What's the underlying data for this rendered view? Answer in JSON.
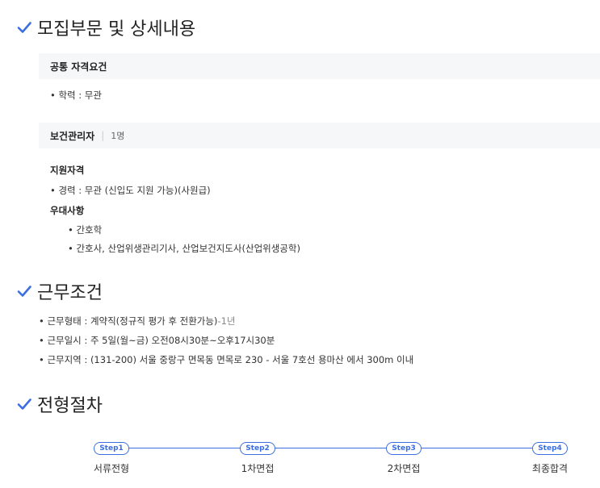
{
  "sections": {
    "recruit": {
      "title": "모집부문 및 상세내용"
    },
    "conditions": {
      "title": "근무조건"
    },
    "process": {
      "title": "전형절차"
    }
  },
  "common": {
    "header": "공통 자격요건",
    "items": [
      "• 학력 : 무관"
    ]
  },
  "position": {
    "name": "보건관리자",
    "count": "1명",
    "qual_title": "지원자격",
    "qual_items": [
      "• 경력 : 무관 (신입도 지원 가능)(사원급)"
    ],
    "pref_title": "우대사항",
    "pref_items": [
      "• 간호학",
      "• 간호사, 산업위생관리기사, 산업보건지도사(산업위생공학)"
    ]
  },
  "conditions": {
    "type_label": "• 근무형태 : 계약직(정규직 평가 후 전환가능)",
    "type_suffix": "-1년",
    "days": "• 근무일시 : 주 5일(월~금) 오전08시30분~오후17시30분",
    "location": "• 근무지역 : (131-200) 서울 중랑구 면목동 면목로 230 - 서울 7호선 용마산 에서 300m 이내"
  },
  "steps": [
    {
      "tag": "Step1",
      "label": "서류전형"
    },
    {
      "tag": "Step2",
      "label": "1차면접"
    },
    {
      "tag": "Step3",
      "label": "2차면접"
    },
    {
      "tag": "Step4",
      "label": "최종합격"
    }
  ],
  "colors": {
    "accent": "#3b6fe0"
  }
}
